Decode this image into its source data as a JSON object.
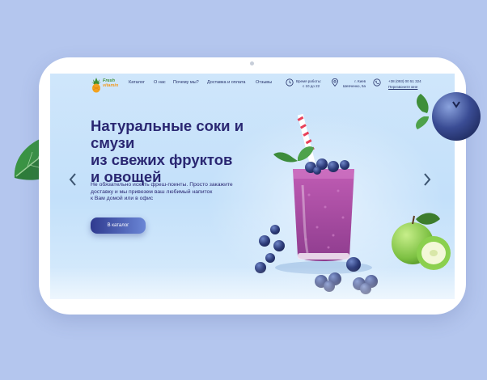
{
  "brand": {
    "logo_line1": "Fresh",
    "logo_line2": "vitamin"
  },
  "nav": {
    "items": [
      {
        "label": "Каталог"
      },
      {
        "label": "О нас"
      },
      {
        "label": "Почему мы?"
      },
      {
        "label": "Доставка и оплата"
      },
      {
        "label": "Отзывы"
      }
    ]
  },
  "header": {
    "hours_line1": "Время работы:",
    "hours_line2": "с 10 до 22",
    "address_line1": "г. Киев",
    "address_line2": "Шевченко, 5а",
    "phone": "+38 (093) 00 51 324",
    "callback_label": "Перезвоните мне"
  },
  "hero": {
    "title_line1": "Натуральные соки и смузи",
    "title_line2": "из свежих фруктов",
    "title_line3": "и овощей",
    "subtitle_line1": "Не обязательно искать фреш-поинты. Просто закажите",
    "subtitle_line2": "доставку и мы привезем ваш любимый напиток",
    "subtitle_line3": "к Вам домой или в офис",
    "cta_label": "В каталог"
  },
  "colors": {
    "background": "#b4c6ee",
    "heading": "#2a2772",
    "smoothie": "#a9489e",
    "accent_button": "#2f3a8f"
  },
  "icons": {
    "clock": "clock-icon",
    "location": "location-pin-icon",
    "phone": "phone-icon",
    "prev": "chevron-left-icon",
    "next": "chevron-right-icon"
  }
}
